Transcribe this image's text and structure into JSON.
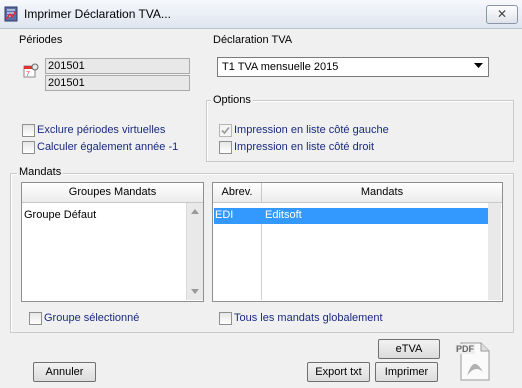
{
  "window": {
    "title": "Imprimer Déclaration TVA...",
    "close_symbol": "✕"
  },
  "periodes": {
    "label": "Périodes",
    "from": "201501",
    "to": "201501"
  },
  "declaration": {
    "label": "Déclaration TVA",
    "selected": "T1 TVA mensuelle 2015"
  },
  "options": {
    "label": "Options",
    "left_list": "Impression en liste côté gauche",
    "right_list": "Impression en liste côté droit",
    "left_checked": true,
    "right_checked": false
  },
  "checks": {
    "exclude_virtual": "Exclure périodes virtuelles",
    "calc_year": "Calculer également année -1"
  },
  "mandats": {
    "label": "Mandats",
    "groups_header": "Groupes Mandats",
    "groups": [
      "Groupe Défaut"
    ],
    "abrev_header": "Abrev.",
    "mandats_header": "Mandats",
    "rows": [
      {
        "abrev": "EDI",
        "name": "Editsoft",
        "selected": true
      }
    ],
    "group_selected": "Groupe sélectionné",
    "all_mandats": "Tous les mandats globalement"
  },
  "buttons": {
    "etva": "eTVA",
    "annuler": "Annuler",
    "export": "Export txt",
    "imprimer": "Imprimer"
  },
  "pdf_label": "PDF",
  "colors": {
    "selection": "#3399ff",
    "label_text": "#1a2a80"
  }
}
